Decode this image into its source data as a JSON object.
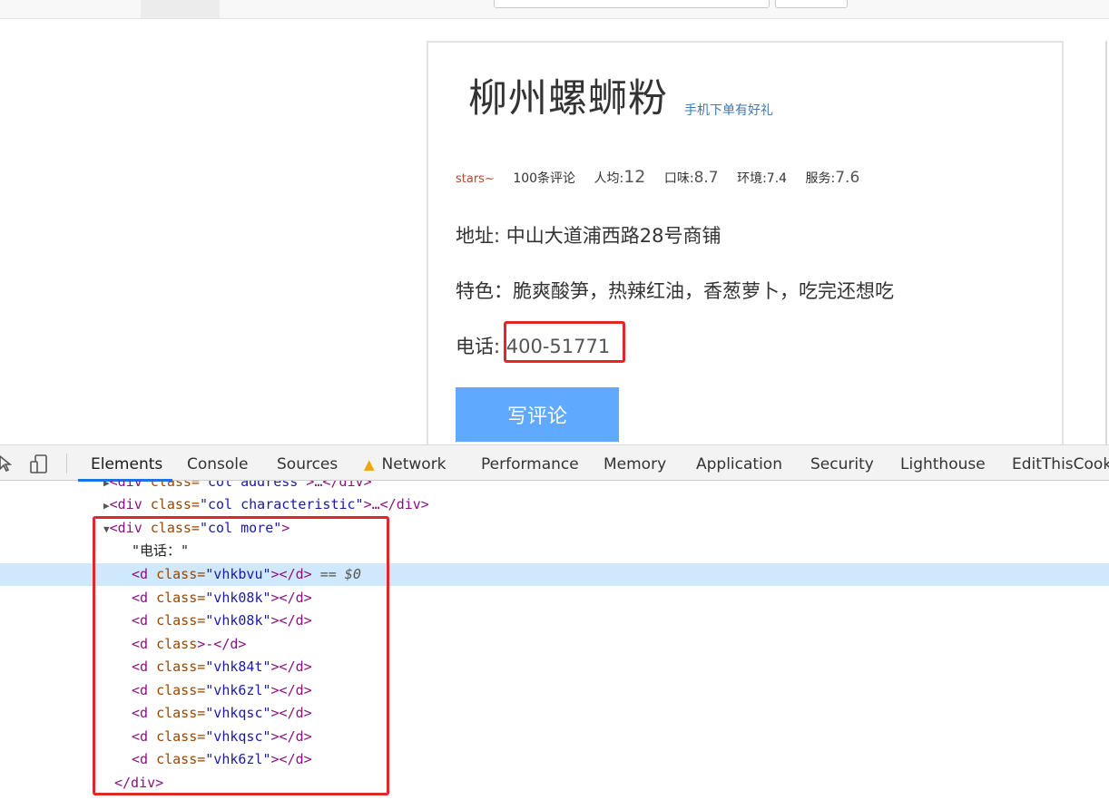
{
  "shop": {
    "name": "柳州螺蛳粉",
    "promo_link": "手机下单有好礼",
    "stars": "stars~",
    "reviews": "100条评论",
    "avg_price_label": "人均:",
    "avg_price_value": "12",
    "taste_label": "口味:",
    "taste_value": "8.7",
    "env_label": "环境:",
    "env_value": "7.4",
    "service_label": "服务:",
    "service_value": "7.6",
    "address": "地址: 中山大道浦西路28号商铺",
    "feature": "特色：脆爽酸笋，热辣红油，香葱萝卜，吃完还想吃",
    "tel_label": "电话:",
    "tel_value": "400-51771",
    "write_review": "写评论"
  },
  "devtools": {
    "tabs": [
      "Elements",
      "Console",
      "Sources",
      "Network",
      "Performance",
      "Memory",
      "Application",
      "Security",
      "Lighthouse",
      "EditThisCooki"
    ],
    "active_tab": "Elements",
    "code_lines": [
      {
        "indent": "    ",
        "tri": "▶",
        "open": "<div",
        "attr": " class=",
        "val": "\"col address\"",
        "close": ">…</div>"
      },
      {
        "indent": "    ",
        "tri": "▶",
        "open": "<div",
        "attr": " class=",
        "val": "\"col characteristic\"",
        "close": ">…</div>"
      },
      {
        "indent": "    ",
        "tri": "▼",
        "open": "<div",
        "attr": " class=",
        "val": "\"col more\"",
        "close": ">"
      },
      {
        "text": "      \"电话：\""
      },
      {
        "indent": "      ",
        "open": "<d",
        "attr": " class=",
        "val": "\"vhkbvu\"",
        "close": "></d>",
        "selected": true,
        "suffix": " == $0"
      },
      {
        "indent": "      ",
        "open": "<d",
        "attr": " class=",
        "val": "\"vhk08k\"",
        "close": "></d>"
      },
      {
        "indent": "      ",
        "open": "<d",
        "attr": " class=",
        "val": "\"vhk08k\"",
        "close": "></d>"
      },
      {
        "indent": "      ",
        "open": "<d",
        "attr": " class",
        "val": "",
        "close": ">-</d>"
      },
      {
        "indent": "      ",
        "open": "<d",
        "attr": " class=",
        "val": "\"vhk84t\"",
        "close": "></d>"
      },
      {
        "indent": "      ",
        "open": "<d",
        "attr": " class=",
        "val": "\"vhk6zl\"",
        "close": "></d>"
      },
      {
        "indent": "      ",
        "open": "<d",
        "attr": " class=",
        "val": "\"vhkqsc\"",
        "close": "></d>"
      },
      {
        "indent": "      ",
        "open": "<d",
        "attr": " class=",
        "val": "\"vhkqsc\"",
        "close": "></d>"
      },
      {
        "indent": "      ",
        "open": "<d",
        "attr": " class=",
        "val": "\"vhk6zl\"",
        "close": "></d>"
      },
      {
        "indent": "    ",
        "open": "</div>",
        "attr": "",
        "val": "",
        "close": ""
      }
    ]
  },
  "colors": {
    "highlight_red": "#e12727",
    "button_blue": "#5fa9ff",
    "link_blue": "#3c7ab3",
    "selection_row": "#cfe8fc"
  },
  "icons": [
    "inspect-cursor-icon",
    "device-toggle-icon",
    "warning-icon"
  ]
}
